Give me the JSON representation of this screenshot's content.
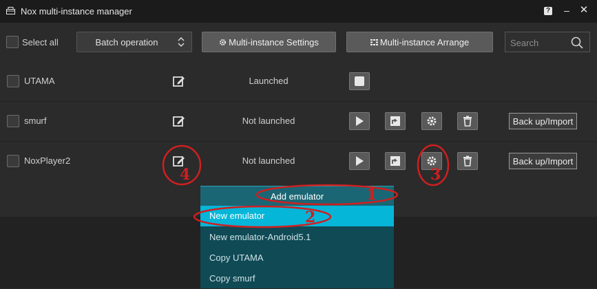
{
  "window": {
    "title": "Nox multi-instance manager",
    "help_label": "?",
    "minimize_label": "–",
    "close_label": "✕"
  },
  "toolbar": {
    "select_all_label": "Select all",
    "batch_label": "Batch operation",
    "settings_label": "Multi-instance Settings",
    "arrange_label": "Multi-instance Arrange",
    "search_placeholder": "Search"
  },
  "instances": [
    {
      "name": "UTAMA",
      "status": "Launched"
    },
    {
      "name": "smurf",
      "status": "Not launched",
      "backup_label": "Back up/Import"
    },
    {
      "name": "NoxPlayer2",
      "status": "Not launched",
      "backup_label": "Back up/Import"
    }
  ],
  "menu": {
    "header": "Add emulator",
    "items": [
      "New emulator",
      "New emulator-Android5.1",
      "Copy UTAMA",
      "Copy smurf"
    ]
  },
  "annotations": [
    "1",
    "2",
    "3",
    "4"
  ],
  "colors": {
    "titlebar": "#1b1b1b",
    "background": "#2b2b2b",
    "menu_background": "#0f4a55",
    "menu_active": "#06b6d9",
    "annotation": "#d01f1f"
  }
}
